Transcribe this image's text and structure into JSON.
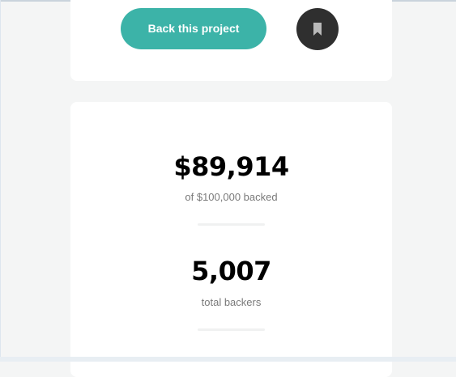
{
  "project_actions": {
    "back_button_label": "Back this project",
    "bookmark_icon": "bookmark-icon"
  },
  "stats": {
    "amount_value": "$89,914",
    "amount_label": "of $100,000 backed",
    "backers_value": "5,007",
    "backers_label": "total backers"
  },
  "colors": {
    "accent": "#3cb3a8",
    "bookmark_bg": "#2f2f2f",
    "page_bg": "#f4f5f5",
    "card_bg": "#ffffff"
  }
}
